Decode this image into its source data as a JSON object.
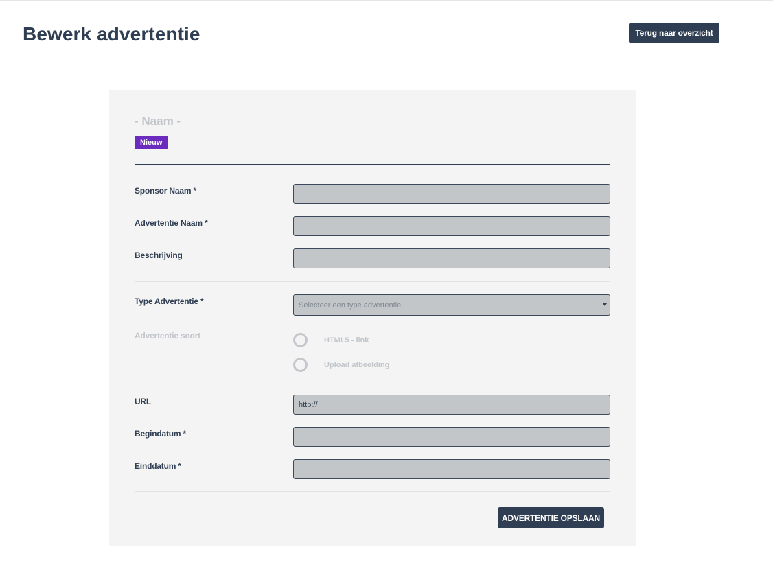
{
  "page": {
    "title": "Bewerk advertentie",
    "back_label": "Terug naar overzicht"
  },
  "card": {
    "name": "- Naam -",
    "badge": "Nieuw",
    "badge_color": "#6c2bbf"
  },
  "form": {
    "sponsor_name": {
      "label": "Sponsor Naam *",
      "value": ""
    },
    "ad_name": {
      "label": "Advertentie Naam *",
      "value": ""
    },
    "description": {
      "label": "Beschrijving",
      "value": ""
    },
    "ad_type": {
      "label": "Type Advertentie *",
      "placeholder": "Selecteer een type advertentie"
    },
    "ad_kind": {
      "label": "Advertentie soort",
      "options": [
        {
          "label": "HTML5 - link",
          "selected": false
        },
        {
          "label": "Upload afbeelding",
          "selected": false
        }
      ]
    },
    "url": {
      "label": "URL",
      "value": "http://"
    },
    "start_date": {
      "label": "Begindatum *",
      "value": ""
    },
    "end_date": {
      "label": "Einddatum *",
      "value": ""
    },
    "save_label": "ADVERTENTIE OPSLAAN"
  },
  "colors": {
    "primary": "#2f3e52",
    "card_background": "#f4f4f4",
    "input_background": "#c3c6c9",
    "muted_text": "#c2c6cb"
  }
}
